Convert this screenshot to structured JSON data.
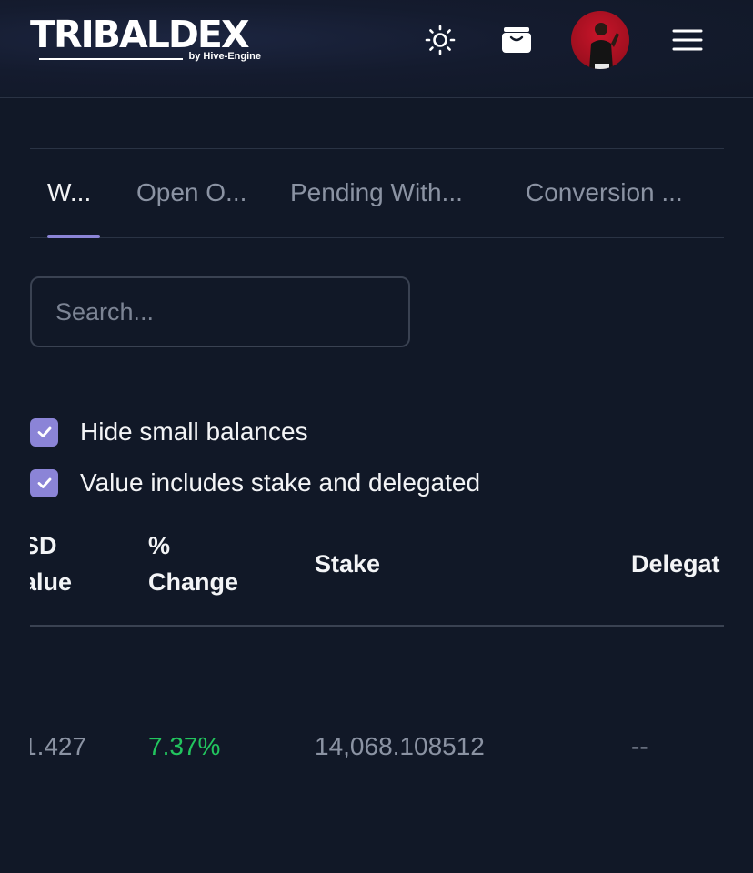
{
  "header": {
    "logo_text": "TRIBALDEX",
    "logo_sub": "by Hive-Engine",
    "icons": [
      "sun-icon",
      "wallet-icon",
      "avatar",
      "hamburger-menu-icon"
    ]
  },
  "tabs": [
    {
      "label": "W..."
    },
    {
      "label": "Open O..."
    },
    {
      "label": "Pending With..."
    },
    {
      "label": "Conversion ..."
    }
  ],
  "search": {
    "placeholder": "Search..."
  },
  "filters": {
    "hide_small": {
      "label": "Hide small balances",
      "checked": true
    },
    "value_includes": {
      "label": "Value includes stake and delegated",
      "checked": true
    }
  },
  "table": {
    "columns": [
      {
        "line1": "SD",
        "line2": "alue"
      },
      {
        "line1": "%",
        "line2": "Change"
      },
      {
        "label": "Stake"
      },
      {
        "label": "Delegat"
      }
    ],
    "rows": [
      {
        "usd_value": "1.427",
        "change": "7.37%",
        "stake": "14,068.108512",
        "delegated": "--"
      }
    ]
  },
  "colors": {
    "background": "#111827",
    "accent": "#8b84d7",
    "positive": "#22c55e",
    "muted": "#8b93a3"
  }
}
